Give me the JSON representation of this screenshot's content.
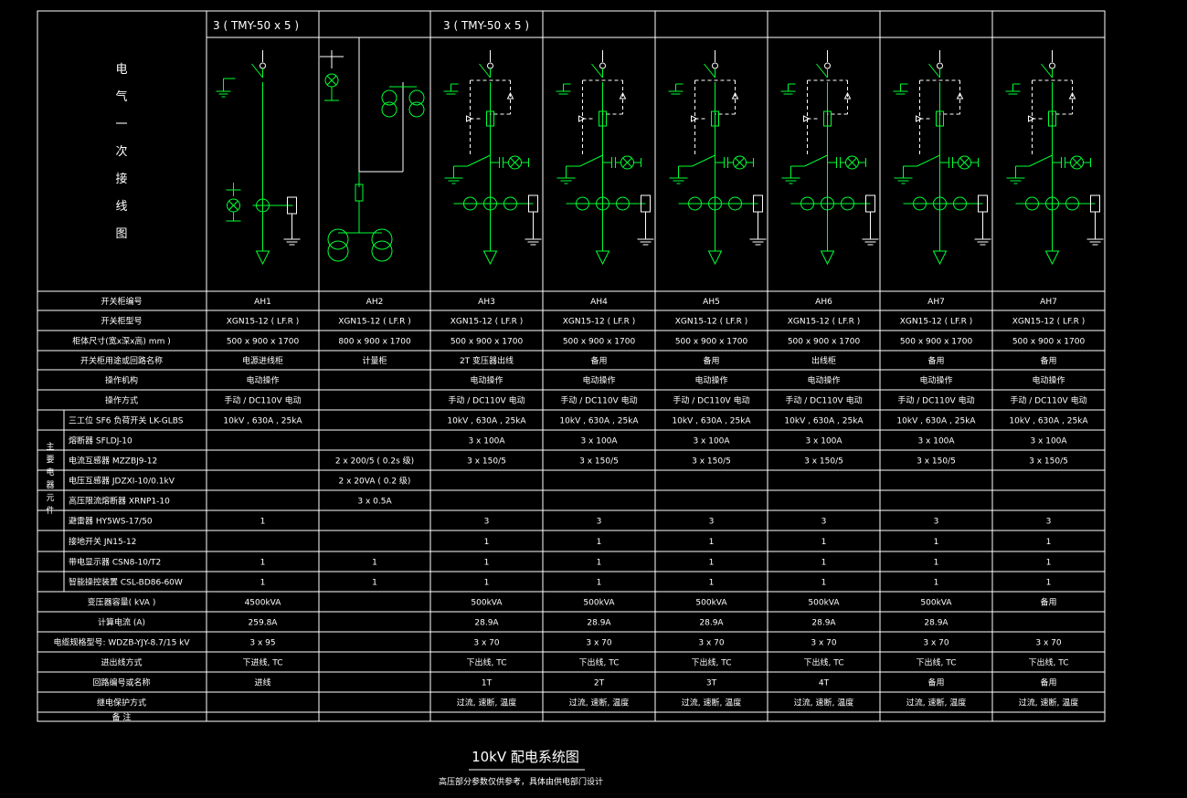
{
  "title": "10kV 配电系统图",
  "subtitle": "高压部分参数仅供参考，具体由供电部门设计",
  "side_title": [
    "电",
    "气",
    "一",
    "次",
    "接",
    "线",
    "图"
  ],
  "busbar_labels": [
    "3 ( TMY-50  x 5 )",
    "3 ( TMY-50  x 5 )"
  ],
  "colors": {
    "background": "#000000",
    "lines": "#ffffff",
    "symbols": "#00ff33"
  },
  "panel_types": [
    "feeder",
    "pt",
    "outgoing",
    "outgoing",
    "outgoing",
    "outgoing",
    "outgoing",
    "outgoing"
  ],
  "row_labels": [
    "开关柜编号",
    "开关柜型号",
    "柜体尺寸(宽x深x高)  mm )",
    "开关柜用途或回路名称",
    "操作机构",
    "操作方式",
    "三工位 SF6  负荷开关  LK-GLBS",
    "熔断器  SFLDJ-10",
    "电流互感器  MZZBJ9-12",
    "电压互感器  JDZXI-10/0.1kV",
    "高压限流熔断器  XRNP1-10",
    "避雷器  HY5WS-17/50",
    "接地开关  JN15-12",
    "带电显示器  CSN8-10/T2",
    "智能操控装置  CSL-BD86-60W",
    "变压器容量(  kVA  )",
    "计算电流  (A)",
    "电缆规格型号:  WDZB-YJY-8.7/15 kV",
    "进出线方式",
    "回路编号或名称",
    "继电保护方式",
    "备   注"
  ],
  "equipment_group": "主要电器元件",
  "table": [
    [
      "AH1",
      "AH2",
      "AH3",
      "AH4",
      "AH5",
      "AH6",
      "AH7",
      "AH7"
    ],
    [
      "XGN15-12  ( LF.R )",
      "XGN15-12  ( LF.R )",
      "XGN15-12  ( LF.R )",
      "XGN15-12  ( LF.R )",
      "XGN15-12  ( LF.R )",
      "XGN15-12  ( LF.R )",
      "XGN15-12  ( LF.R )",
      "XGN15-12  ( LF.R )"
    ],
    [
      "500  x 900  x 1700",
      "800  x 900  x 1700",
      "500  x 900  x 1700",
      "500  x 900  x 1700",
      "500  x 900  x 1700",
      "500  x 900  x 1700",
      "500  x 900  x 1700",
      "500  x 900  x 1700"
    ],
    [
      "电源进线柜",
      "计量柜",
      "2T 变压器出线",
      "备用",
      "备用",
      "出线柜",
      "备用",
      "备用"
    ],
    [
      "电动操作",
      "",
      "电动操作",
      "电动操作",
      "电动操作",
      "电动操作",
      "电动操作",
      "电动操作"
    ],
    [
      "手动 / DC110V   电动",
      "",
      "手动 / DC110V   电动",
      "手动 / DC110V   电动",
      "手动 / DC110V   电动",
      "手动 / DC110V   电动",
      "手动 / DC110V   电动",
      "手动 / DC110V   电动"
    ],
    [
      "10kV , 630A , 25kA",
      "",
      "10kV , 630A , 25kA",
      "10kV , 630A , 25kA",
      "10kV , 630A , 25kA",
      "10kV , 630A , 25kA",
      "10kV , 630A , 25kA",
      "10kV , 630A , 25kA"
    ],
    [
      "",
      "",
      "3 x 100A",
      "3 x 100A",
      "3 x 100A",
      "3 x 100A",
      "3 x 100A",
      "3 x 100A"
    ],
    [
      "",
      "2 x 200/5  ( 0.2s 级)",
      "3 x 150/5",
      "3 x 150/5",
      "3 x 150/5",
      "3 x 150/5",
      "3 x 150/5",
      "3 x 150/5"
    ],
    [
      "",
      "2 x 20VA  ( 0.2 级)",
      "",
      "",
      "",
      "",
      "",
      ""
    ],
    [
      "",
      "3 x 0.5A",
      "",
      "",
      "",
      "",
      "",
      ""
    ],
    [
      "1",
      "",
      "3",
      "3",
      "3",
      "3",
      "3",
      "3"
    ],
    [
      "",
      "",
      "1",
      "1",
      "1",
      "1",
      "1",
      "1"
    ],
    [
      "1",
      "1",
      "1",
      "1",
      "1",
      "1",
      "1",
      "1"
    ],
    [
      "1",
      "1",
      "1",
      "1",
      "1",
      "1",
      "1",
      "1"
    ],
    [
      "4500kVA",
      "",
      "500kVA",
      "500kVA",
      "500kVA",
      "500kVA",
      "500kVA",
      "备用"
    ],
    [
      "259.8A",
      "",
      "28.9A",
      "28.9A",
      "28.9A",
      "28.9A",
      "28.9A",
      ""
    ],
    [
      "3 x 95",
      "",
      "3 x 70",
      "3 x 70",
      "3 x 70",
      "3 x 70",
      "3 x 70",
      "3 x 70"
    ],
    [
      "下进线, TC",
      "",
      "下出线, TC",
      "下出线, TC",
      "下出线, TC",
      "下出线, TC",
      "下出线, TC",
      "下出线, TC"
    ],
    [
      "进线",
      "",
      "1T",
      "2T",
      "3T",
      "4T",
      "备用",
      "备用"
    ],
    [
      "",
      "",
      "过流, 速断, 温度",
      "过流, 速断, 温度",
      "过流, 速断, 温度",
      "过流, 速断, 温度",
      "过流, 速断, 温度",
      "过流, 速断, 温度"
    ],
    [
      "",
      "",
      "",
      "",
      "",
      "",
      "",
      ""
    ]
  ]
}
